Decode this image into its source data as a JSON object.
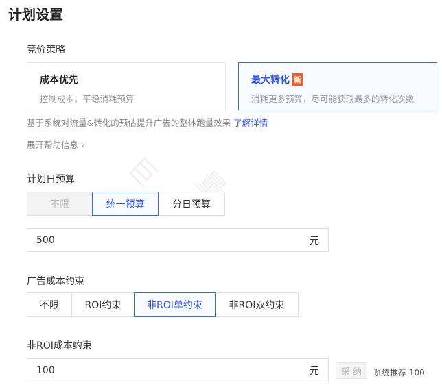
{
  "title": "计划设置",
  "bid_strategy": {
    "label": "竞价策略",
    "cards": [
      {
        "title": "成本优先",
        "desc": "控制成本，平稳消耗预算"
      },
      {
        "title": "最大转化",
        "badge": "新",
        "desc": "消耗更多预算，尽可能获取最多的转化次数"
      }
    ],
    "hint": "基于系统对流量&转化的预估提升广告的整体跑量效果",
    "learn_more": "了解详情",
    "expand": "展开帮助信息"
  },
  "budget": {
    "label": "计划日预算",
    "options": [
      "不限",
      "统一预算",
      "分日预算"
    ],
    "value": "500",
    "unit": "元"
  },
  "cost_constraint": {
    "label": "广告成本约束",
    "options": [
      "不限",
      "ROI约束",
      "非ROI单约束",
      "非ROI双约束"
    ]
  },
  "non_roi": {
    "label": "非ROI成本约束",
    "value": "100",
    "unit": "元",
    "adopt": "采 纳",
    "recommend": "系统推荐 100"
  },
  "watermark": "巨量"
}
